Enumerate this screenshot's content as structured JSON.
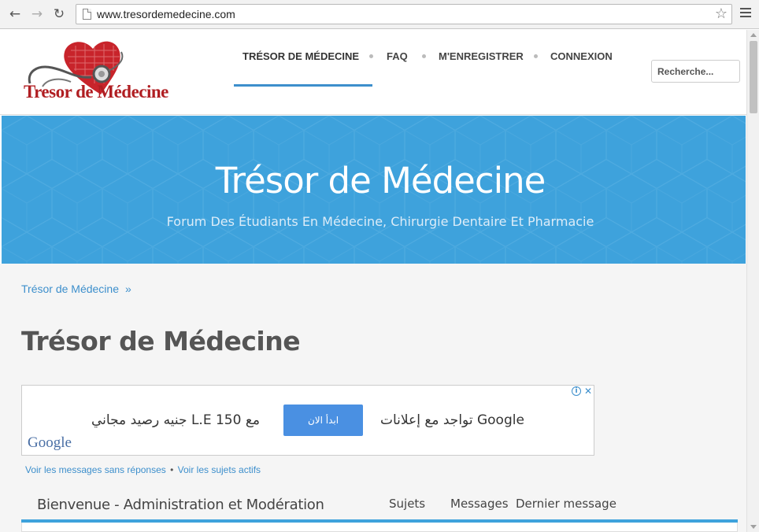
{
  "browser": {
    "url": "www.tresordemedecine.com"
  },
  "header": {
    "logo_text": "Tresor de Médecine",
    "nav": [
      {
        "label": "TRÉSOR DE MÉDECINE",
        "active": true
      },
      {
        "label": "FAQ"
      },
      {
        "label": "M'ENREGISTRER"
      },
      {
        "label": "CONNEXION"
      }
    ],
    "search_placeholder": "Recherche..."
  },
  "banner": {
    "title": "Trésor de Médecine",
    "subtitle": "Forum Des Étudiants En Médecine, Chirurgie Dentaire Et Pharmacie"
  },
  "breadcrumb": {
    "label": "Trésor de Médecine",
    "separator": "»"
  },
  "page_title": "Trésor de Médecine",
  "ad": {
    "right_text": "تواجد مع إعلانات Google",
    "cta_label": "ابدأ الان",
    "left_text": "مع 150 L.E جنيه رصيد مجاني",
    "google_logo": "Google",
    "choices_icon": "i",
    "close_icon": "✕"
  },
  "forum_links": {
    "unanswered": "Voir les messages sans réponses",
    "separator": "•",
    "active": "Voir les sujets actifs"
  },
  "forum": {
    "category": "Bienvenue - Administration et Modération",
    "col_topics": "Sujets",
    "col_messages": "Messages",
    "col_last": "Dernier message"
  },
  "colors": {
    "accent": "#3d8fcc",
    "banner": "#3ea2dc",
    "logo_red": "#b01e22"
  }
}
